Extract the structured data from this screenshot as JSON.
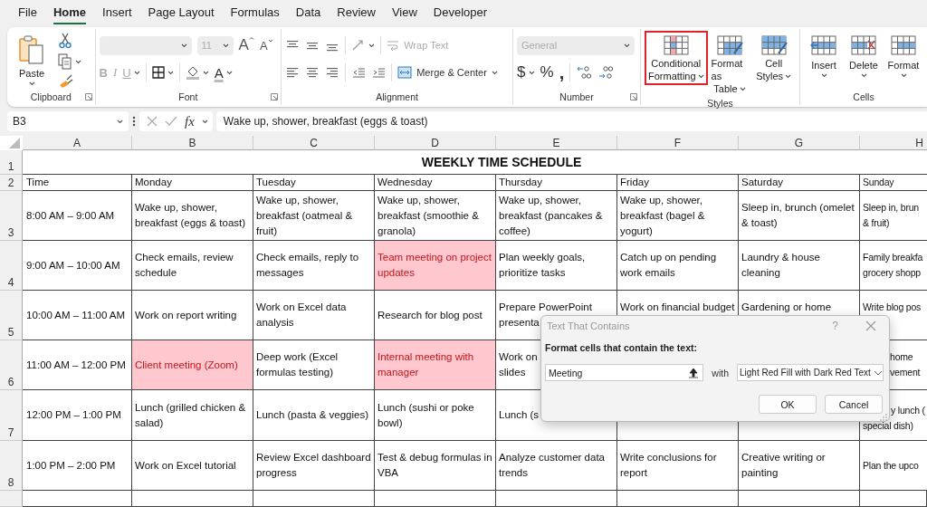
{
  "menu_tabs": [
    {
      "label": "File",
      "selected": false
    },
    {
      "label": "Home",
      "selected": true
    },
    {
      "label": "Insert",
      "selected": false
    },
    {
      "label": "Page Layout",
      "selected": false
    },
    {
      "label": "Formulas",
      "selected": false
    },
    {
      "label": "Data",
      "selected": false
    },
    {
      "label": "Review",
      "selected": false
    },
    {
      "label": "View",
      "selected": false
    },
    {
      "label": "Developer",
      "selected": false
    }
  ],
  "ribbon": {
    "clipboard": {
      "label": "Clipboard",
      "paste": "Paste"
    },
    "font": {
      "label": "Font",
      "font_name": {
        "disabled": true
      },
      "size": {
        "value": "11",
        "disabled": true
      },
      "grow": "A",
      "shrink": "A",
      "bold": {
        "label": "B",
        "disabled": true
      },
      "italic": {
        "label": "I",
        "disabled": true
      },
      "underline": {
        "label": "U",
        "disabled": true
      },
      "font_color": "A"
    },
    "alignment": {
      "label": "Alignment",
      "wrap_text": {
        "label": "Wrap Text",
        "disabled": true
      },
      "merge": {
        "label": "Merge & Center",
        "disabled": false
      }
    },
    "number": {
      "label": "Number",
      "format": {
        "value": "General",
        "disabled": true
      },
      "currency": "$",
      "percent": "%",
      "comma": ","
    },
    "styles": {
      "label": "Styles",
      "buttons": [
        {
          "lines": [
            "Conditional",
            "Formatting"
          ],
          "outlined": true
        },
        {
          "lines": [
            "Format as",
            "Table"
          ],
          "outlined": false
        },
        {
          "lines": [
            "Cell",
            "Styles"
          ],
          "outlined": false
        }
      ]
    },
    "cells": {
      "label": "Cells",
      "buttons": [
        "Insert",
        "Delete",
        "Format"
      ]
    }
  },
  "formula_bar": {
    "name_box": "B3",
    "function_label": "fx",
    "formula": "Wake up, shower, breakfast (eggs & toast)"
  },
  "sheet": {
    "columns": [
      "A",
      "B",
      "C",
      "D",
      "E",
      "F",
      "G",
      "H"
    ],
    "title": {
      "row": "1",
      "text": "WEEKLY TIME SCHEDULE"
    },
    "rows": [
      {
        "number": "2",
        "cells": [
          {
            "text": "Time"
          },
          {
            "text": "Monday"
          },
          {
            "text": "Tuesday"
          },
          {
            "text": "Wednesday"
          },
          {
            "text": "Thursday"
          },
          {
            "text": "Friday"
          },
          {
            "text": "Saturday"
          },
          {
            "text": "Sunday"
          }
        ]
      },
      {
        "number": "3",
        "cells": [
          {
            "text": "8:00 AM – 9:00 AM"
          },
          {
            "text": "Wake up, shower,\nbreakfast (eggs & toast)"
          },
          {
            "text": "Wake up, shower,\nbreakfast (oatmeal &\nfruit)"
          },
          {
            "text": "Wake up, shower,\nbreakfast (smoothie &\ngranola)"
          },
          {
            "text": "Wake up, shower,\nbreakfast (pancakes &\ncoffee)"
          },
          {
            "text": "Wake up, shower,\nbreakfast (bagel &\nyogurt)"
          },
          {
            "text": "Sleep in, brunch (omelet\n& toast)"
          },
          {
            "text": "Sleep in, brun\n& fruit)"
          }
        ]
      },
      {
        "number": "4",
        "cells": [
          {
            "text": "9:00 AM – 10:00 AM"
          },
          {
            "text": "Check emails, review\nschedule"
          },
          {
            "text": "Check emails, reply to\nmessages"
          },
          {
            "text": "Team meeting on project\nupdates",
            "highlight": true
          },
          {
            "text": "Plan weekly goals,\nprioritize tasks"
          },
          {
            "text": "Catch up on pending\nwork emails"
          },
          {
            "text": "Laundry & house\ncleaning"
          },
          {
            "text": "Family breakfa\ngrocery shopp"
          }
        ]
      },
      {
        "number": "5",
        "cells": [
          {
            "text": "10:00 AM – 11:00 AM"
          },
          {
            "text": "Work on report writing"
          },
          {
            "text": "Work on Excel data\nanalysis"
          },
          {
            "text": "Research for blog post"
          },
          {
            "text": "Prepare PowerPoint\npresenta"
          },
          {
            "text": "Work on financial budget",
            "kind": "top"
          },
          {
            "text": "Gardening or home",
            "kind": "top"
          },
          {
            "text": "Write blog pos",
            "kind": "top"
          }
        ]
      },
      {
        "number": "6",
        "cells": [
          {
            "text": "11:00 AM – 12:00 PM"
          },
          {
            "text": "Client meeting (Zoom)",
            "highlight": true
          },
          {
            "text": "Deep work (Excel\nformulas testing)"
          },
          {
            "text": "Internal meeting with\nmanager",
            "highlight": true
          },
          {
            "text": "Work on\nslides"
          },
          "",
          "",
          {
            "text": "home\nvement",
            "kind": "shifted"
          }
        ]
      },
      {
        "number": "7",
        "cells": [
          {
            "text": "12:00 PM – 1:00 PM"
          },
          {
            "text": "Lunch (grilled chicken &\nsalad)"
          },
          {
            "text": "Lunch (pasta & veggies)"
          },
          {
            "text": "Lunch (sushi or poke\nbowl)"
          },
          {
            "text": "Lunch (s"
          },
          {},
          {},
          {
            "text": "y lunch (\nspecial dish)",
            "kind": "indented"
          }
        ]
      },
      {
        "number": "8",
        "cells": [
          {
            "text": "1:00 PM – 2:00 PM"
          },
          {
            "text": "Work on Excel tutorial"
          },
          {
            "text": "Review Excel dashboard\nprogress"
          },
          {
            "text": "Test & debug formulas in\nVBA"
          },
          {
            "text": "Analyze customer data\ntrends"
          },
          {
            "text": "Write conclusions for\nreport"
          },
          {
            "text": "Creative writing or\npainting"
          },
          {
            "text": "Plan the upco"
          }
        ]
      }
    ]
  },
  "dialog": {
    "title": "Text That Contains",
    "help": "?",
    "prompt": "Format cells that contain the text:",
    "value": "Meeting",
    "with": "with",
    "format": "Light Red Fill with Dark Red Text",
    "buttons": [
      "OK",
      "Cancel"
    ]
  }
}
